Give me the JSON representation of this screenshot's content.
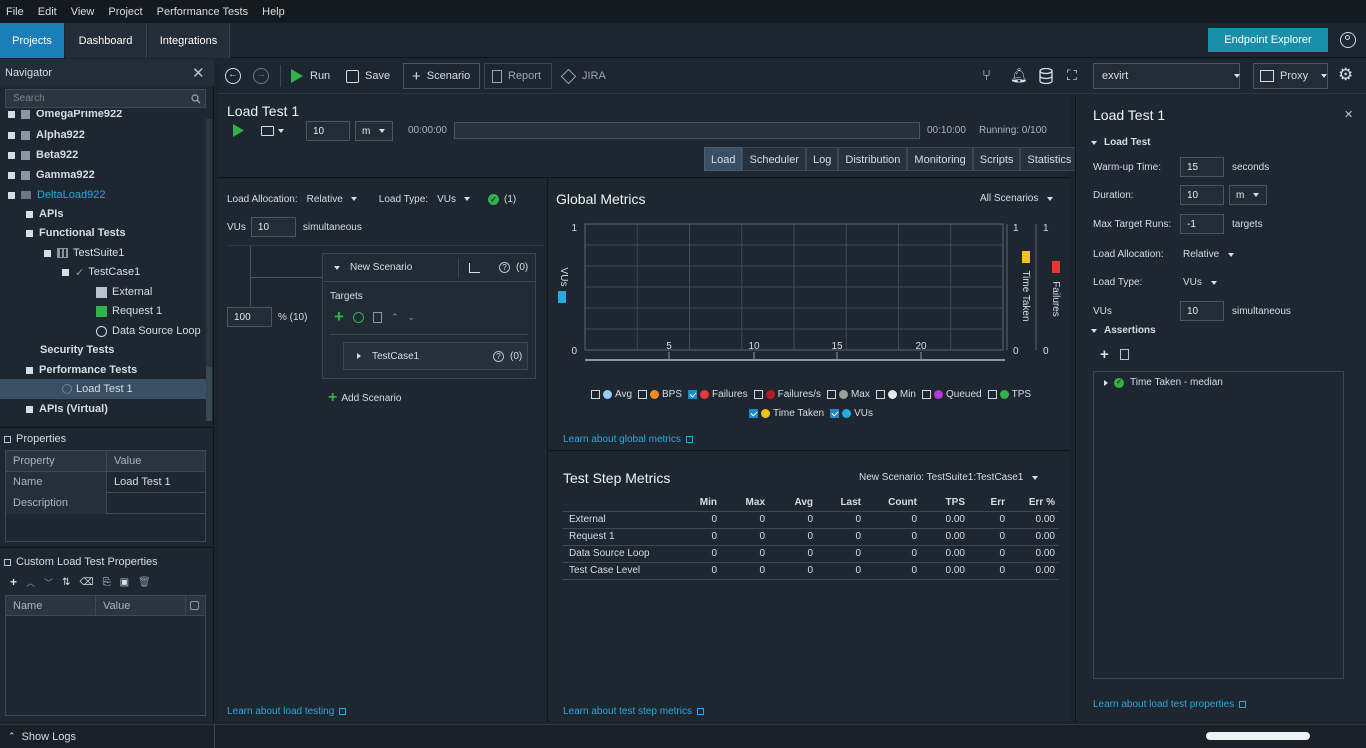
{
  "menu": [
    "File",
    "Edit",
    "View",
    "Project",
    "Performance Tests",
    "Help"
  ],
  "top_tabs": [
    "Projects",
    "Dashboard",
    "Integrations"
  ],
  "endpoint_explorer": "Endpoint Explorer",
  "navigator": {
    "title": "Navigator",
    "search_placeholder": "Search",
    "tree": [
      {
        "label": "OmegaPrime922",
        "indent": 0
      },
      {
        "label": "Alpha922",
        "indent": 0
      },
      {
        "label": "Beta922",
        "indent": 0
      },
      {
        "label": "Gamma922",
        "indent": 0
      },
      {
        "label": "DeltaLoad922",
        "indent": 0
      },
      {
        "label": "APIs",
        "indent": 1
      },
      {
        "label": "Functional Tests",
        "indent": 1
      },
      {
        "label": "TestSuite1",
        "indent": 2
      },
      {
        "label": "TestCase1",
        "indent": 3
      },
      {
        "label": "External",
        "indent": 4
      },
      {
        "label": "Request 1",
        "indent": 4
      },
      {
        "label": "Data Source Loop",
        "indent": 4
      },
      {
        "label": "Security Tests",
        "indent": 1
      },
      {
        "label": "Performance Tests",
        "indent": 1
      },
      {
        "label": "Load Test 1",
        "indent": 3
      },
      {
        "label": "APIs (Virtual)",
        "indent": 1
      }
    ]
  },
  "properties": {
    "title": "Properties",
    "col_property": "Property",
    "col_value": "Value",
    "rows": [
      {
        "property": "Name",
        "value": "Load Test 1"
      },
      {
        "property": "Description",
        "value": ""
      }
    ]
  },
  "custom_props": {
    "title": "Custom Load Test Properties",
    "col_name": "Name",
    "col_value": "Value"
  },
  "show_logs": "Show Logs",
  "toolbar": {
    "run": "Run",
    "save": "Save",
    "scenario": "Scenario",
    "report": "Report",
    "jira": "JIRA",
    "env": "exvirt",
    "proxy": "Proxy"
  },
  "load_test": {
    "title": "Load Test 1",
    "duration_value": "10",
    "duration_unit": "m",
    "time_start": "00:00:00",
    "time_end": "00:10:00",
    "running": "Running: 0/100",
    "tabs": [
      "Load",
      "Scheduler",
      "Log",
      "Distribution",
      "Monitoring",
      "Scripts",
      "Statistics"
    ]
  },
  "scenario_panel": {
    "load_allocation_label": "Load Allocation:",
    "load_allocation_value": "Relative",
    "load_type_label": "Load Type:",
    "load_type_value": "VUs",
    "count_badge": "(1)",
    "vus_label": "VUs",
    "vus_value": "10",
    "simultaneous": "simultaneous",
    "percent_value": "100",
    "percent_label": "% (10)",
    "scenario_name": "New Scenario",
    "scenario_count": "(0)",
    "targets_label": "Targets",
    "target_name": "TestCase1",
    "target_count": "(0)",
    "add_scenario": "Add Scenario",
    "learn_link": "Learn about load testing"
  },
  "global_metrics": {
    "title": "Global Metrics",
    "filter": "All Scenarios",
    "y_left_label": "VUs",
    "y_right1_label": "Time Taken",
    "y_right2_label": "Failures",
    "y_top": "1",
    "y_bottom": "0",
    "x_ticks": [
      "5",
      "10",
      "15",
      "20"
    ],
    "legend": [
      {
        "label": "Avg",
        "checked": false,
        "color": "#8fd0f5"
      },
      {
        "label": "BPS",
        "checked": false,
        "color": "#f08a24"
      },
      {
        "label": "Failures",
        "checked": true,
        "color": "#e53935"
      },
      {
        "label": "Failures/s",
        "checked": false,
        "color": "#b71c1c"
      },
      {
        "label": "Max",
        "checked": false,
        "color": "#9e9e9e"
      },
      {
        "label": "Min",
        "checked": false,
        "color": "#e8eaed"
      },
      {
        "label": "Queued",
        "checked": false,
        "color": "#b03ad6"
      },
      {
        "label": "TPS",
        "checked": false,
        "color": "#2fb34a"
      },
      {
        "label": "Time Taken",
        "checked": true,
        "color": "#f2c11c"
      },
      {
        "label": "VUs",
        "checked": true,
        "color": "#2aa6e0"
      }
    ],
    "learn_link": "Learn about global metrics"
  },
  "test_step": {
    "title": "Test Step Metrics",
    "filter": "New Scenario: TestSuite1:TestCase1",
    "columns": [
      "",
      "Min",
      "Max",
      "Avg",
      "Last",
      "Count",
      "TPS",
      "Err",
      "Err %"
    ],
    "rows": [
      [
        "External",
        "0",
        "0",
        "0",
        "0",
        "0",
        "0.00",
        "0",
        "0.00"
      ],
      [
        "Request 1",
        "0",
        "0",
        "0",
        "0",
        "0",
        "0.00",
        "0",
        "0.00"
      ],
      [
        "Data Source Loop",
        "0",
        "0",
        "0",
        "0",
        "0",
        "0.00",
        "0",
        "0.00"
      ],
      [
        "Test Case Level",
        "0",
        "0",
        "0",
        "0",
        "0",
        "0.00",
        "0",
        "0.00"
      ]
    ],
    "learn_link": "Learn about test step metrics"
  },
  "right_panel": {
    "title": "Load Test 1",
    "section": "Load Test",
    "warmup_label": "Warm-up Time:",
    "warmup_value": "15",
    "warmup_unit": "seconds",
    "duration_label": "Duration:",
    "duration_value": "10",
    "duration_unit": "m",
    "max_runs_label": "Max Target Runs:",
    "max_runs_value": "-1",
    "max_runs_unit": "targets",
    "load_alloc_label": "Load Allocation:",
    "load_alloc_value": "Relative",
    "load_type_label": "Load Type:",
    "load_type_value": "VUs",
    "vus_label": "VUs",
    "vus_value": "10",
    "vus_unit": "simultaneous",
    "assertions_label": "Assertions",
    "assertion_item": "Time Taken - median",
    "learn_link": "Learn about load test properties"
  }
}
